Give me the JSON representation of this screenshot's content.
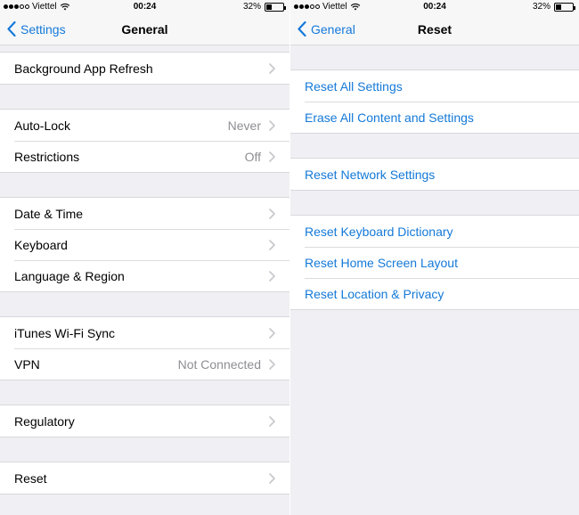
{
  "status": {
    "carrier": "Viettel",
    "time": "00:24",
    "battery": "32%",
    "battery_fraction": 0.32
  },
  "general": {
    "back_label": "Settings",
    "title": "General",
    "groups": [
      {
        "items": [
          {
            "label": "Background App Refresh",
            "value": ""
          }
        ]
      },
      {
        "items": [
          {
            "label": "Auto-Lock",
            "value": "Never"
          },
          {
            "label": "Restrictions",
            "value": "Off"
          }
        ]
      },
      {
        "items": [
          {
            "label": "Date & Time",
            "value": ""
          },
          {
            "label": "Keyboard",
            "value": ""
          },
          {
            "label": "Language & Region",
            "value": ""
          }
        ]
      },
      {
        "items": [
          {
            "label": "iTunes Wi-Fi Sync",
            "value": ""
          },
          {
            "label": "VPN",
            "value": "Not Connected"
          }
        ]
      },
      {
        "items": [
          {
            "label": "Regulatory",
            "value": ""
          }
        ]
      },
      {
        "items": [
          {
            "label": "Reset",
            "value": ""
          }
        ]
      }
    ]
  },
  "reset": {
    "back_label": "General",
    "title": "Reset",
    "groups": [
      {
        "items": [
          {
            "label": "Reset All Settings"
          },
          {
            "label": "Erase All Content and Settings"
          }
        ]
      },
      {
        "items": [
          {
            "label": "Reset Network Settings"
          }
        ]
      },
      {
        "items": [
          {
            "label": "Reset Keyboard Dictionary"
          },
          {
            "label": "Reset Home Screen Layout"
          },
          {
            "label": "Reset Location & Privacy"
          }
        ]
      }
    ]
  },
  "colors": {
    "accent": "#1479d8",
    "background": "#efeff4",
    "secondary_text": "#8e8e93"
  }
}
